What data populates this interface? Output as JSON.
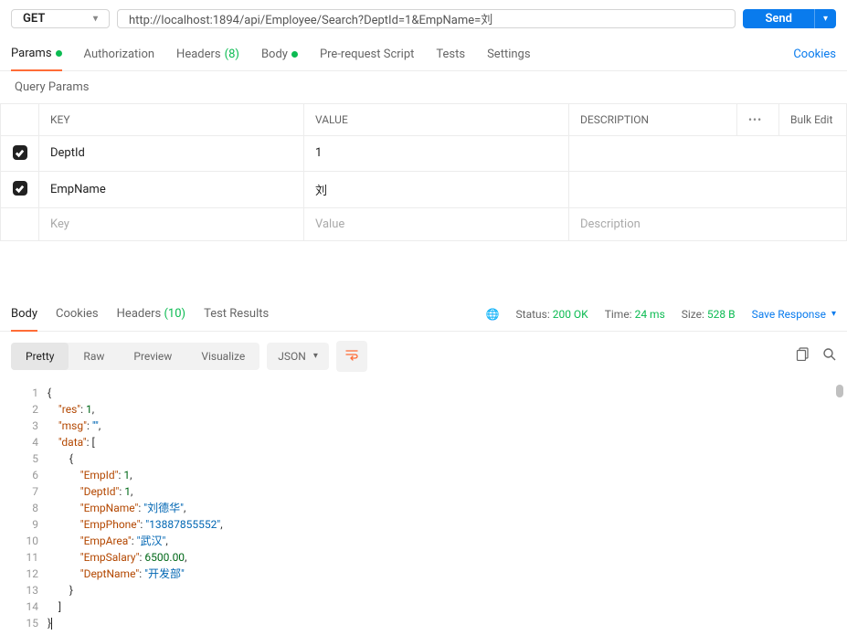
{
  "request": {
    "method": "GET",
    "url": "http://localhost:1894/api/Employee/Search?DeptId=1&EmpName=刘",
    "send_label": "Send"
  },
  "tabs": {
    "params": "Params",
    "authorization": "Authorization",
    "headers": "Headers",
    "headers_count": "(8)",
    "body": "Body",
    "prerequest": "Pre-request Script",
    "tests": "Tests",
    "settings": "Settings",
    "cookies": "Cookies"
  },
  "sub_head": "Query Params",
  "table": {
    "head_key": "KEY",
    "head_value": "VALUE",
    "head_desc": "DESCRIPTION",
    "bulk_edit": "Bulk Edit",
    "rows": [
      {
        "key": "DeptId",
        "value": "1",
        "desc": ""
      },
      {
        "key": "EmpName",
        "value": "刘",
        "desc": ""
      }
    ],
    "placeholder_key": "Key",
    "placeholder_value": "Value",
    "placeholder_desc": "Description"
  },
  "response_tabs": {
    "body": "Body",
    "cookies": "Cookies",
    "headers": "Headers",
    "headers_count": "(10)",
    "test_results": "Test Results"
  },
  "response_meta": {
    "status_label": "Status:",
    "status_value": "200 OK",
    "time_label": "Time:",
    "time_value": "24 ms",
    "size_label": "Size:",
    "size_value": "528 B",
    "save_response": "Save Response"
  },
  "view_tabs": {
    "pretty": "Pretty",
    "raw": "Raw",
    "preview": "Preview",
    "visualize": "Visualize",
    "format": "JSON"
  },
  "response_body": {
    "res": 1,
    "msg": "",
    "data": [
      {
        "EmpId": 1,
        "DeptId": 1,
        "EmpName": "刘德华",
        "EmpPhone": "13887855552",
        "EmpArea": "武汉",
        "EmpSalary": 6500.0,
        "DeptName": "开发部"
      }
    ]
  },
  "line_count": 15
}
